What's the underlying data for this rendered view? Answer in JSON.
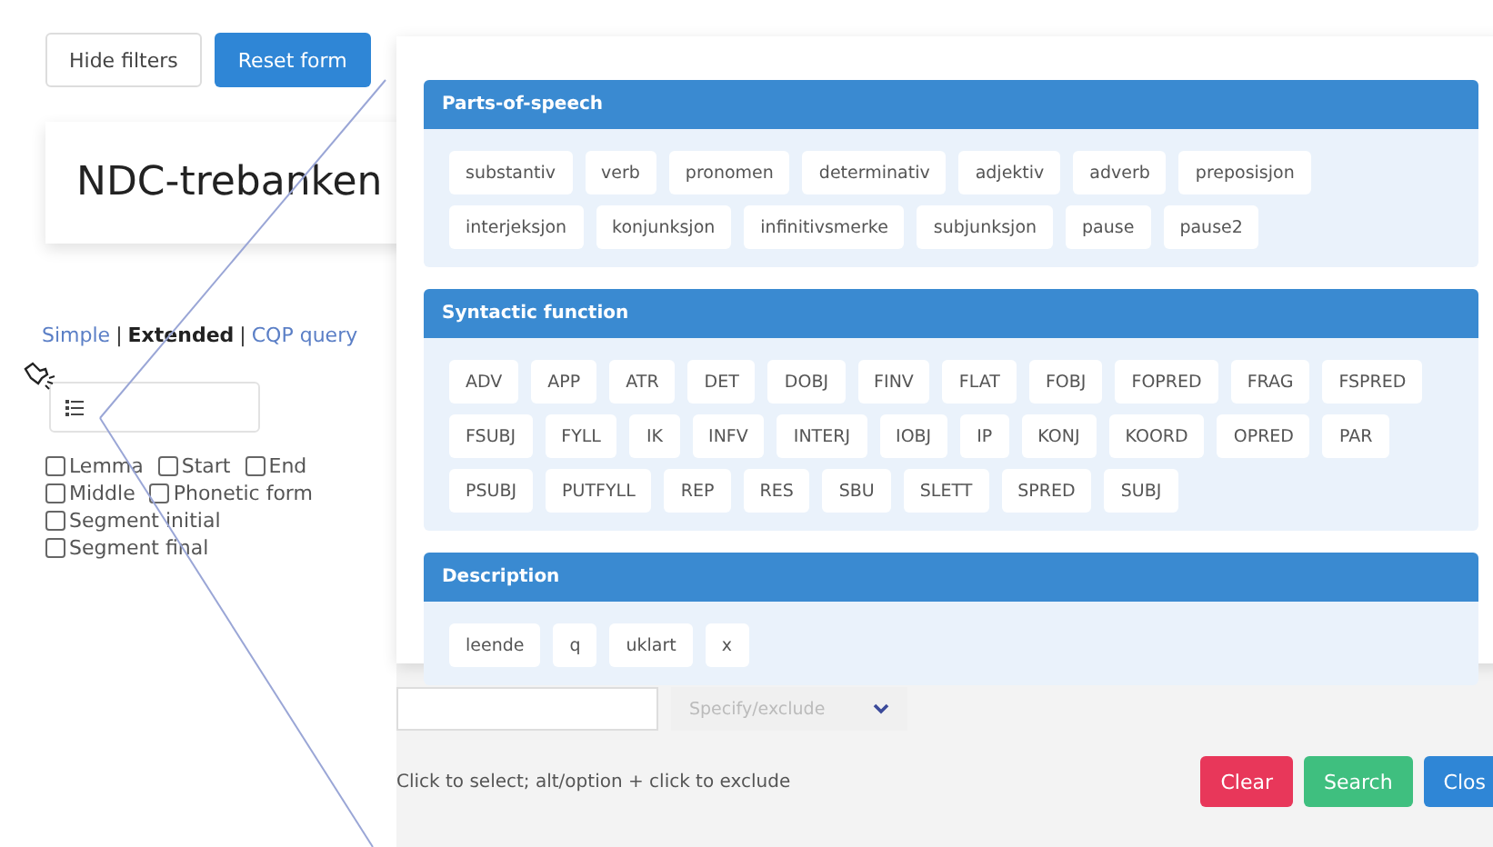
{
  "toolbar": {
    "buttons": [
      {
        "label": "Hide filters",
        "kind": "default"
      },
      {
        "label": "Reset form",
        "kind": "primary"
      }
    ]
  },
  "corpus_title": "NDC-trebanken",
  "mode_separator": "|",
  "modes": [
    {
      "label": "Simple",
      "selected": false
    },
    {
      "label": "Extended",
      "selected": true
    },
    {
      "label": "CQP query",
      "selected": false
    }
  ],
  "option_rows": [
    [
      {
        "label": "Lemma",
        "checked": false
      },
      {
        "label": "Start",
        "checked": false
      },
      {
        "label": "End",
        "checked": false
      }
    ],
    [
      {
        "label": "Middle",
        "checked": false
      },
      {
        "label": "Phonetic form",
        "checked": false
      }
    ],
    [
      {
        "label": "Segment initial",
        "checked": false
      }
    ],
    [
      {
        "label": "Segment final",
        "checked": false
      }
    ]
  ],
  "sections": [
    {
      "title": "Parts-of-speech",
      "tags": [
        "substantiv",
        "verb",
        "pronomen",
        "determinativ",
        "adjektiv",
        "adverb",
        "preposisjon",
        "interjeksjon",
        "konjunksjon",
        "infinitivsmerke",
        "subjunksjon",
        "pause",
        "pause2"
      ]
    },
    {
      "title": "Syntactic function",
      "tags": [
        "ADV",
        "APP",
        "ATR",
        "DET",
        "DOBJ",
        "FINV",
        "FLAT",
        "FOBJ",
        "FOPRED",
        "FRAG",
        "FSPRED",
        "FSUBJ",
        "FYLL",
        "IK",
        "INFV",
        "INTERJ",
        "IOBJ",
        "IP",
        "KONJ",
        "KOORD",
        "OPRED",
        "PAR",
        "PSUBJ",
        "PUTFYLL",
        "REP",
        "RES",
        "SBU",
        "SLETT",
        "SPRED",
        "SUBJ"
      ]
    },
    {
      "title": "Description",
      "tags": [
        "leende",
        "q",
        "uklart",
        "x"
      ]
    }
  ],
  "specify": {
    "placeholder": "Specify/exclude"
  },
  "hint": "Click to select; alt/option + click to exclude",
  "buttons": [
    {
      "label": "Clear",
      "kind": "danger"
    },
    {
      "label": "Search",
      "kind": "success"
    },
    {
      "label": "Clos",
      "kind": "primary"
    }
  ]
}
